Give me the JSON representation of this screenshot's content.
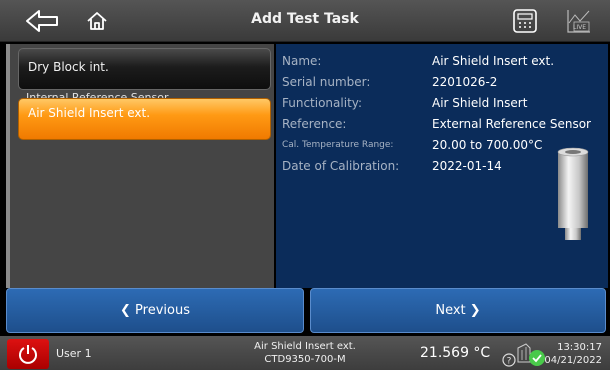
{
  "header": {
    "title": "Add Test Task",
    "back_icon": "back-arrow-icon",
    "home_icon": "home-icon",
    "calculator_icon": "calculator-icon",
    "live_icon": "live-chart-icon",
    "live_label": "LIVE"
  },
  "list": {
    "items": [
      {
        "label": "Dry Block int."
      },
      {
        "label": "Internal Reference Sensor"
      },
      {
        "label": "Air Shield Insert ext."
      }
    ],
    "ghost_text": "",
    "selected_index": 2,
    "selected_color": "#ff9a14"
  },
  "details": {
    "fields": [
      {
        "label": "Name:",
        "value": "Air Shield Insert ext."
      },
      {
        "label": "Serial number:",
        "value": "2201026-2"
      },
      {
        "label": "Functionality:",
        "value": "Air Shield Insert"
      },
      {
        "label": "Reference:",
        "value": "External Reference Sensor"
      },
      {
        "label": "Cal. Temperature Range:",
        "value": "20.00 to 700.00°C"
      },
      {
        "label": "Date of Calibration:",
        "value": "2022-01-14"
      }
    ]
  },
  "nav": {
    "previous_label": "❮ Previous",
    "next_label": "Next ❯"
  },
  "status": {
    "user": "User 1",
    "device_line1": "Air Shield Insert ext.",
    "device_line2": "CTD9350-700-M",
    "temperature": "21.569 °C",
    "time": "13:30:17",
    "date": "04/21/2022",
    "power_icon": "power-icon",
    "status_icons": [
      "info-icon",
      "stable-check-icon"
    ],
    "accent_red": "#cc1111",
    "check_green": "#49c94a"
  }
}
